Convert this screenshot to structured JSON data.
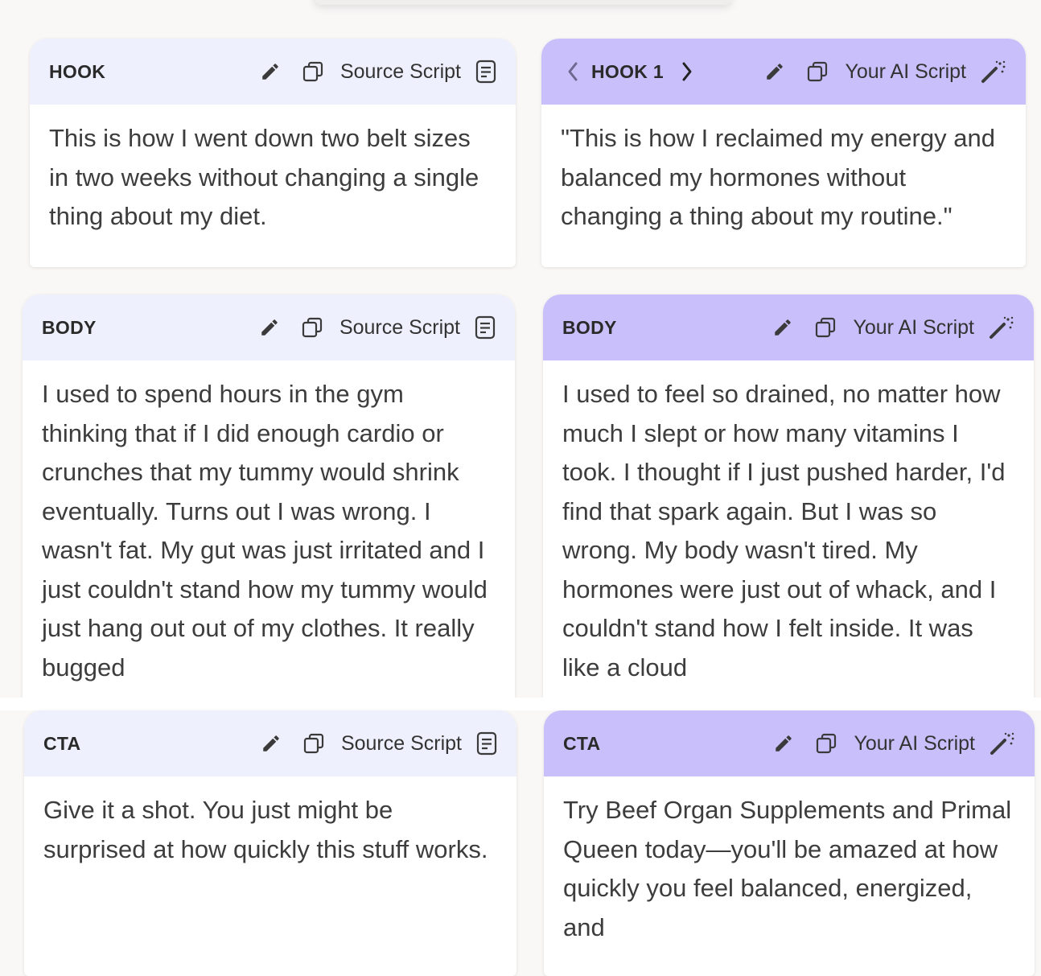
{
  "rows": {
    "hook": {
      "source": {
        "label": "HOOK",
        "script_label": "Source Script",
        "text": "This is how I went down two belt sizes in two weeks without changing a single thing about my diet."
      },
      "ai": {
        "label": "HOOK 1",
        "script_label": "Your AI Script",
        "text": "\"This is how I reclaimed my energy and balanced my hormones without changing a thing about my routine.\""
      }
    },
    "body": {
      "source": {
        "label": "BODY",
        "script_label": "Source Script",
        "text": "I used to spend hours in the gym thinking that if I did enough cardio or crunches that my tummy would shrink eventually. Turns out I was wrong. I wasn't fat. My gut was just irritated and I just couldn't stand how my tummy would just hang out out of my clothes. It really bugged"
      },
      "ai": {
        "label": "BODY",
        "script_label": "Your AI Script",
        "text": "I used to feel so drained, no matter how much I slept or how many vitamins I took. I thought if I just pushed harder, I'd find that spark again. But I was so wrong. My body wasn't tired. My hormones were just out of whack, and I couldn't stand how I felt inside. It was like a cloud"
      }
    },
    "cta": {
      "source": {
        "label": "CTA",
        "script_label": "Source Script",
        "text": "Give it a shot. You just might be surprised at how quickly this stuff works."
      },
      "ai": {
        "label": "CTA",
        "script_label": "Your AI Script",
        "text": "Try Beef Organ Supplements and Primal Queen today—you'll be amazed at how quickly you feel balanced, energized, and"
      }
    }
  },
  "icons": {
    "edit": "pencil-icon",
    "copy": "copy-icon",
    "source": "document-icon",
    "ai": "magic-wand-icon",
    "prev": "chevron-left-icon",
    "next": "chevron-right-icon"
  },
  "colors": {
    "source_header": "#eef1fd",
    "ai_header": "#c9c0fb",
    "background": "#faf8f7"
  }
}
